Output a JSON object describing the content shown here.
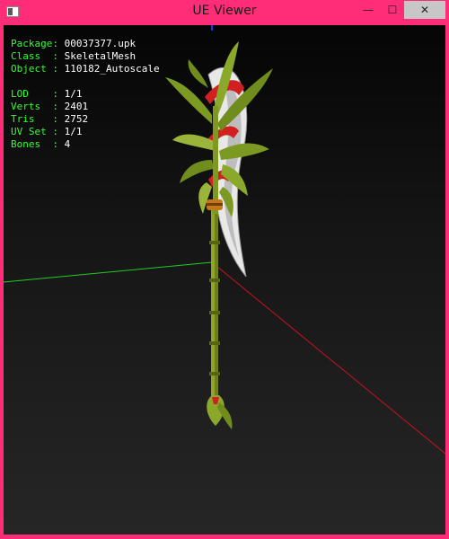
{
  "window": {
    "title": "UE Viewer",
    "minimize_glyph": "—",
    "maximize_glyph": "☐",
    "close_glyph": "✕",
    "frame_color": "#ff2d78"
  },
  "info": {
    "package": {
      "label": "Package: ",
      "value": "00037377.upk"
    },
    "class": {
      "label": "Class  : ",
      "value": "SkeletalMesh"
    },
    "object": {
      "label": "Object : ",
      "value": "110182_Autoscale"
    },
    "lod": {
      "label": "LOD    : ",
      "value": "1/1"
    },
    "verts": {
      "label": "Verts  : ",
      "value": "2401"
    },
    "tris": {
      "label": "Tris   : ",
      "value": "2752"
    },
    "uvset": {
      "label": "UV Set : ",
      "value": "1/1"
    },
    "bones": {
      "label": "Bones  : ",
      "value": "4"
    }
  },
  "colors": {
    "label_text": "#33ff33",
    "value_text": "#ffffff",
    "axis_x": "#cc1122",
    "axis_y": "#22cc22",
    "axis_z": "#2233ff"
  }
}
